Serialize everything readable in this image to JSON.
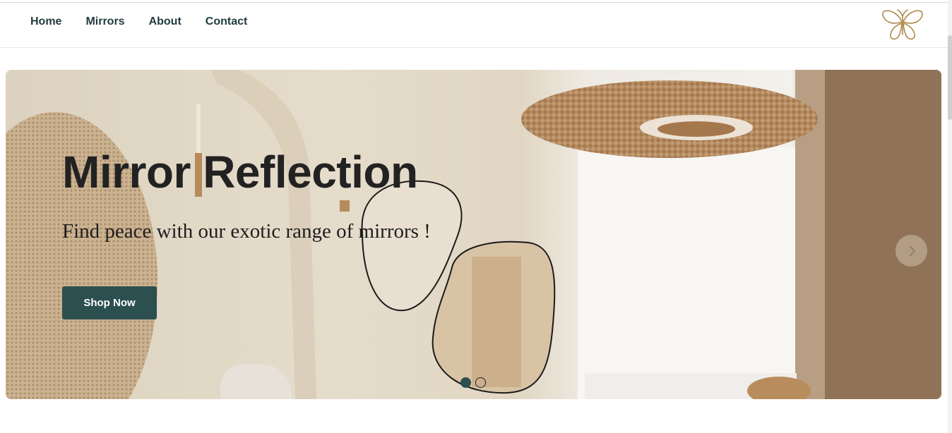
{
  "nav": {
    "links": [
      "Home",
      "Mirrors",
      "About",
      "Contact"
    ],
    "logo_icon": "butterfly-icon"
  },
  "hero": {
    "title": "Mirror Reflection",
    "subtitle": "Find peace with our exotic range of mirrors !",
    "cta_label": "Shop Now",
    "next_icon": "chevron-right-icon",
    "slides_count": 2,
    "active_slide": 1
  },
  "colors": {
    "accent": "#2c4f4f",
    "nav_text": "#1f3b3f",
    "logo_gold": "#b08a4e"
  }
}
